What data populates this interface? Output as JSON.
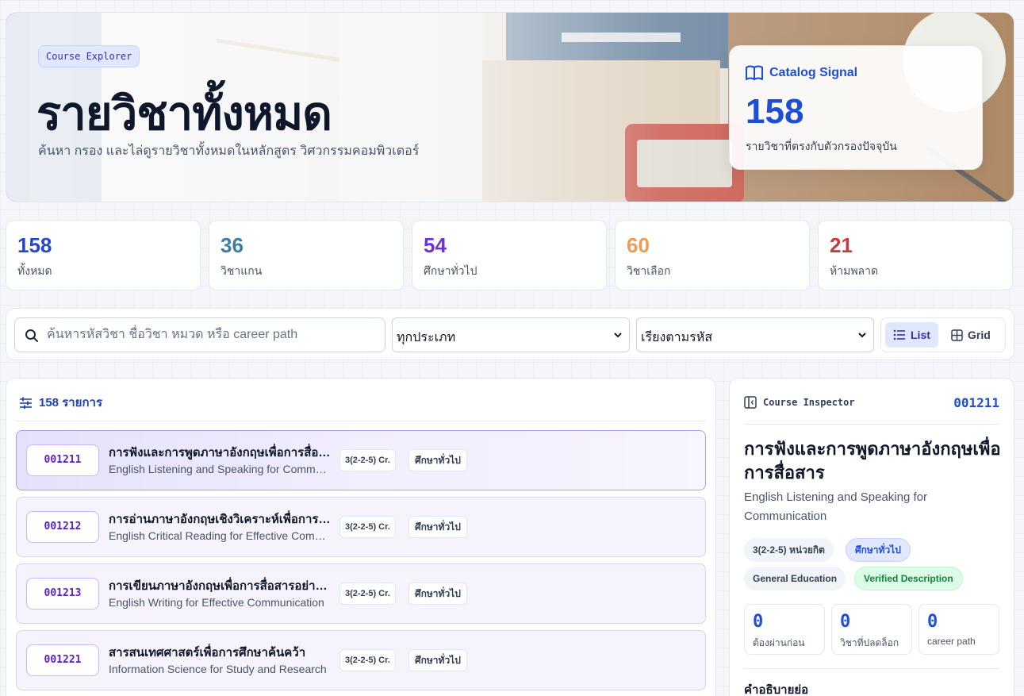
{
  "hero": {
    "chip": "Course Explorer",
    "title": "รายวิชาทั้งหมด",
    "subtitle": "ค้นหา กรอง และไล่ดูรายวิชาทั้งหมดในหลักสูตร วิศวกรรมคอมพิวเตอร์",
    "signal": {
      "label": "Catalog Signal",
      "value": "158",
      "caption": "รายวิชาที่ตรงกับตัวกรองปัจจุบัน"
    }
  },
  "stats": [
    {
      "value": "158",
      "label": "ทั้งหมด",
      "color": "#2547c8"
    },
    {
      "value": "36",
      "label": "วิชาแกน",
      "color": "#3b7ea6"
    },
    {
      "value": "54",
      "label": "ศึกษาทั่วไป",
      "color": "#6d32d4"
    },
    {
      "value": "60",
      "label": "วิชาเลือก",
      "color": "#ef9a55"
    },
    {
      "value": "21",
      "label": "ห้ามพลาด",
      "color": "#c93b3b"
    }
  ],
  "toolbar": {
    "search_placeholder": "ค้นหารหัสวิชา ชื่อวิชา หมวด หรือ career path",
    "search_value": "",
    "type_filter": "ทุกประเภท",
    "sort": "เรียงตามรหัส",
    "view_list": "List",
    "view_grid": "Grid"
  },
  "list": {
    "count_label": "158 รายการ",
    "rows": [
      {
        "code": "001211",
        "th": "การฟังและการพูดภาษาอังกฤษเพื่อการสื่อสาร",
        "en": "English Listening and Speaking for Communication",
        "credit": "3(2-2-5) Cr.",
        "category": "ศึกษาทั่วไป"
      },
      {
        "code": "001212",
        "th": "การอ่านภาษาอังกฤษเชิงวิเคราะห์เพื่อการสื่อสารอย่างมีประสิทธิภาพ",
        "en": "English Critical Reading for Effective Communication",
        "credit": "3(2-2-5) Cr.",
        "category": "ศึกษาทั่วไป"
      },
      {
        "code": "001213",
        "th": "การเขียนภาษาอังกฤษเพื่อการสื่อสารอย่างมีประสิทธิภาพ",
        "en": "English Writing for Effective Communication",
        "credit": "3(2-2-5) Cr.",
        "category": "ศึกษาทั่วไป"
      },
      {
        "code": "001221",
        "th": "สารสนเทศศาสตร์เพื่อการศึกษาค้นคว้า",
        "en": "Information Science for Study and Research",
        "credit": "3(2-2-5) Cr.",
        "category": "ศึกษาทั่วไป"
      }
    ]
  },
  "inspector": {
    "label": "Course Inspector",
    "code": "001211",
    "title": "การฟังและการพูดภาษาอังกฤษเพื่อการสื่อสาร",
    "en": "English Listening and Speaking for Communication",
    "tags": [
      "3(2-2-5) หน่วยกิต",
      "ศึกษาทั่วไป",
      "General Education",
      "Verified Description"
    ],
    "metrics": [
      {
        "value": "0",
        "label": "ต้องผ่านก่อน"
      },
      {
        "value": "0",
        "label": "วิชาที่ปลดล็อก"
      },
      {
        "value": "0",
        "label": "career path"
      }
    ],
    "desc_heading": "คำอธิบายย่อ"
  }
}
